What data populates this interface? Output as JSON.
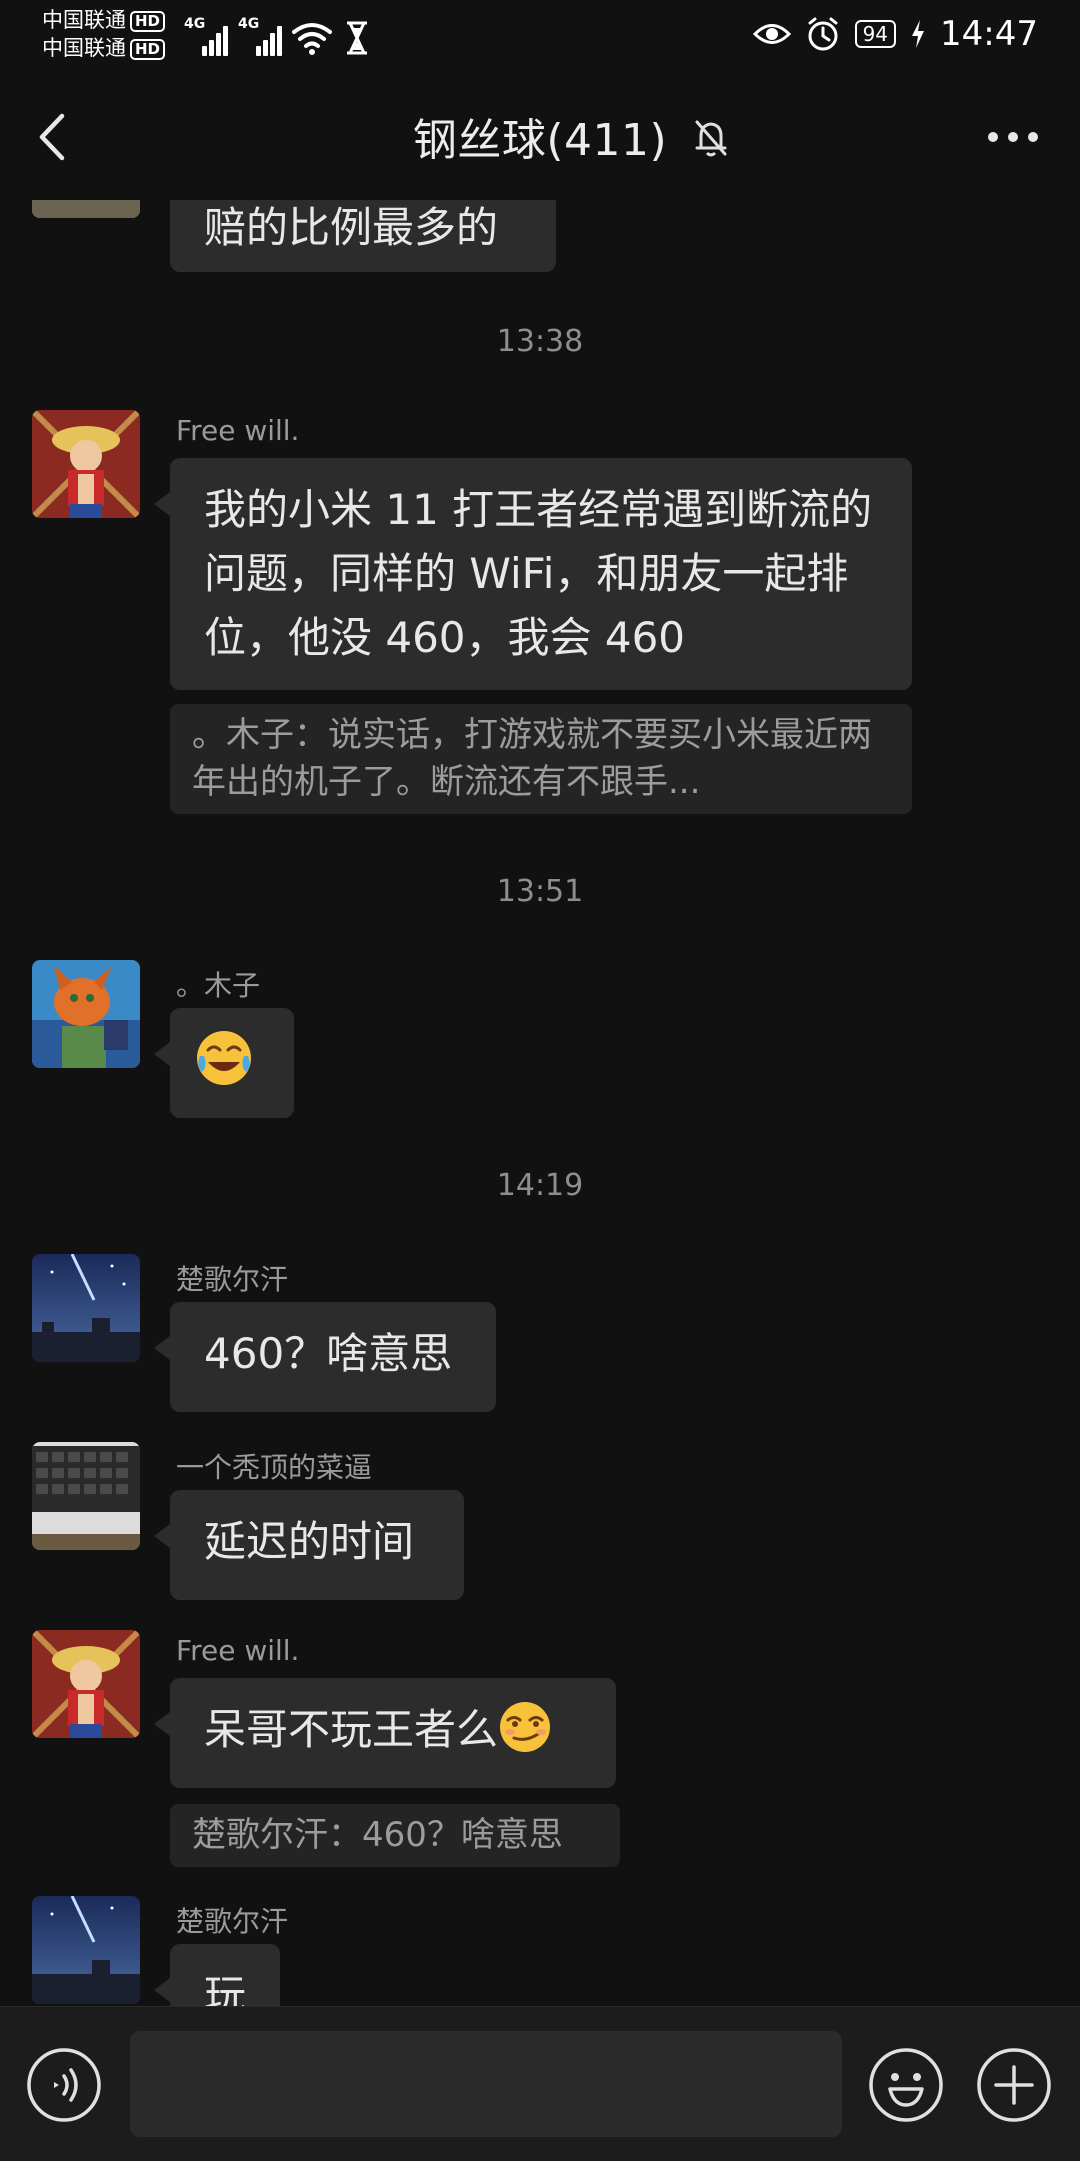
{
  "status_bar": {
    "carrier_1": "中国联通",
    "carrier_2": "中国联通",
    "hd_badge": "HD",
    "network_type_1": "4G",
    "network_type_2": "4G",
    "battery": "94",
    "time": "14:47"
  },
  "header": {
    "title": "钢丝球(411)",
    "mute_icon": "bell-off-icon",
    "more_icon": "more-dots-icon"
  },
  "messages": [
    {
      "kind": "partial",
      "text": "赔的比例最多的"
    },
    {
      "kind": "time",
      "text": "13:38"
    },
    {
      "kind": "message",
      "sender": "Free will.",
      "text": "我的小米 11 打王者经常遇到断流的问题，同样的 WiFi，和朋友一起排位，他没 460，我会 460",
      "quote": "。木子：说实话，打游戏就不要买小米最近两年出的机子了。断流还有不跟手..."
    },
    {
      "kind": "time",
      "text": "13:51"
    },
    {
      "kind": "message",
      "sender": "。木子",
      "emoji": "crying-laughing-emoji"
    },
    {
      "kind": "time",
      "text": "14:19"
    },
    {
      "kind": "message",
      "sender": "楚歌尔汗",
      "text": "460？啥意思"
    },
    {
      "kind": "message",
      "sender": "一个秃顶的菜逼",
      "text": "延迟的时间"
    },
    {
      "kind": "message",
      "sender": "Free will.",
      "text": "呆哥不玩王者么",
      "emoji": "smirk-emoji",
      "quote": "楚歌尔汗：460？啥意思"
    },
    {
      "kind": "message",
      "sender": "楚歌尔汗",
      "text": "玩"
    }
  ],
  "input_bar": {
    "voice_icon": "voice-icon",
    "text_value": "",
    "emoji_icon": "emoji-icon",
    "plus_icon": "plus-icon"
  },
  "colors": {
    "background": "#111111",
    "bubble": "#2c2c2c",
    "quote": "#242424",
    "secondary_text": "#9a9a9a"
  }
}
